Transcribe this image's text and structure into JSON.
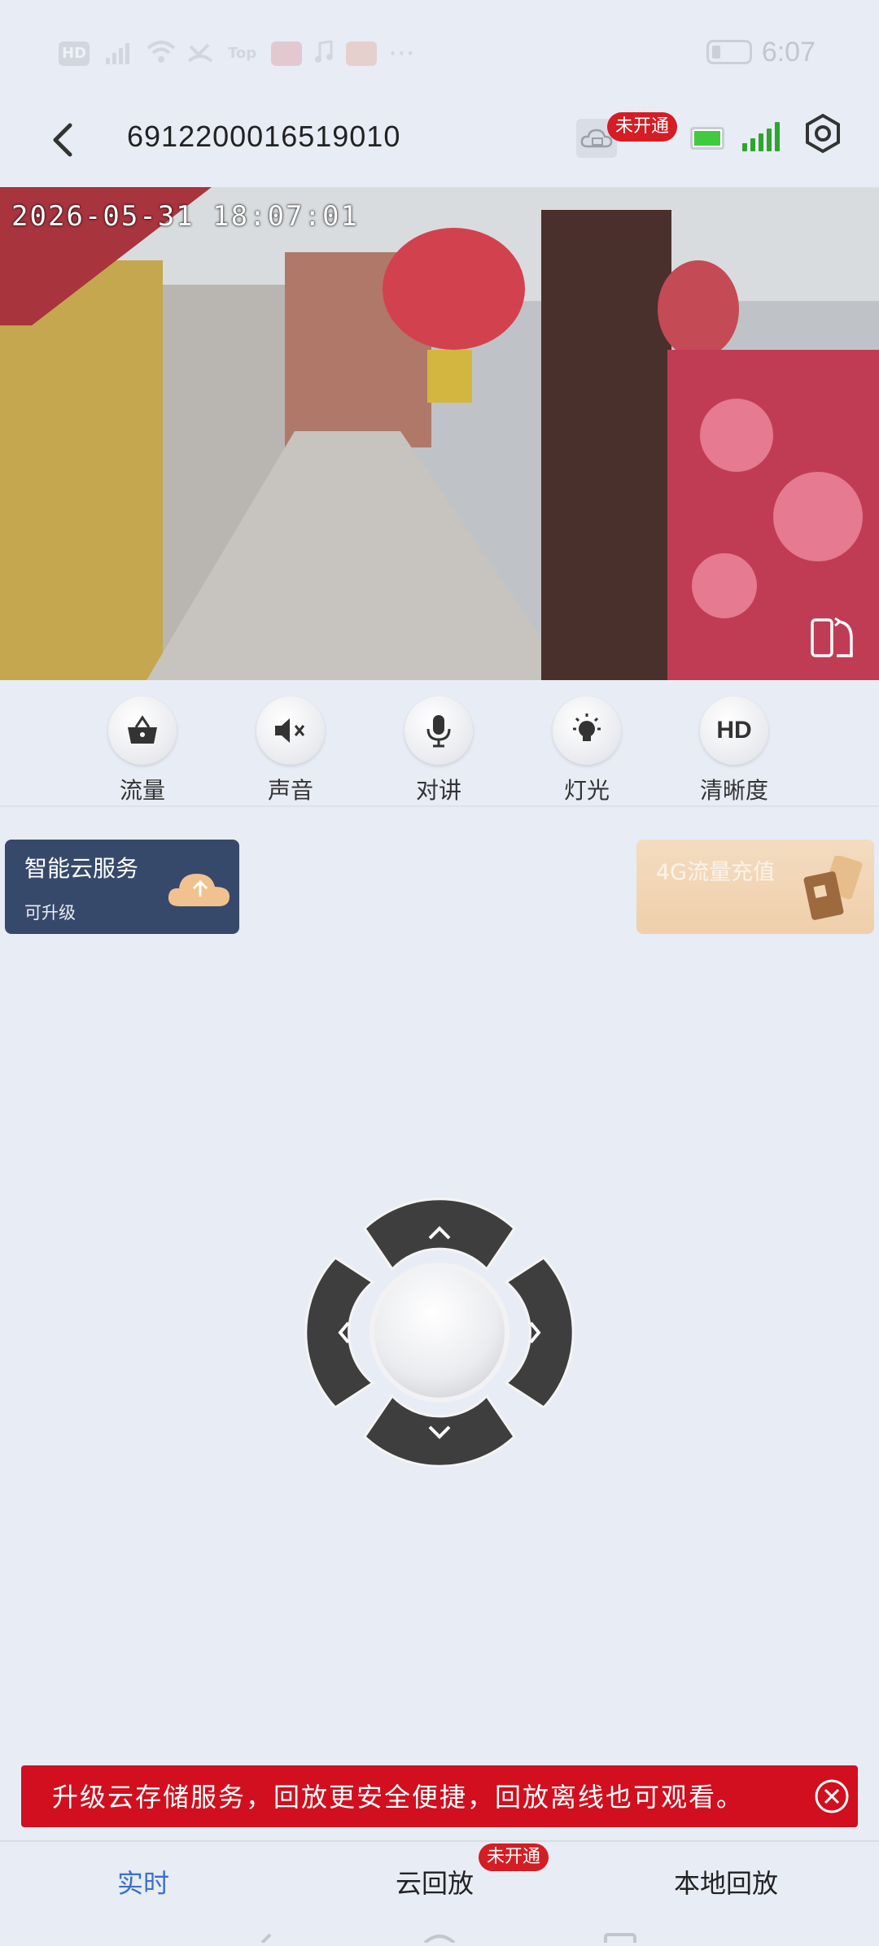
{
  "status_bar": {
    "left_icons": [
      "hd-icon",
      "4g-signal-icon",
      "wifi-icon",
      "missed-call-icon",
      "top-icon",
      "app-icon",
      "music-icon",
      "app2-icon",
      "more-dots-icon"
    ],
    "hd_label": "HD",
    "top_label": "Top",
    "dots": "···",
    "time": "6:07"
  },
  "header": {
    "title": "6912200016519010",
    "cloud_badge": "未开通"
  },
  "video": {
    "timestamp": "2026-05-31 18:07:01"
  },
  "controls": [
    {
      "label": "流量",
      "icon": "basket-icon"
    },
    {
      "label": "声音",
      "icon": "speaker-mute-icon"
    },
    {
      "label": "对讲",
      "icon": "microphone-icon"
    },
    {
      "label": "灯光",
      "icon": "light-bulb-icon"
    },
    {
      "label": "清晰度",
      "icon": "hd-icon",
      "icon_text": "HD"
    }
  ],
  "promo": {
    "cloud_title": "智能云服务",
    "cloud_sub": "可升级",
    "flow_title": "4G流量充值"
  },
  "banner": {
    "text": "升级云存储服务，回放更安全便捷，回放离线也可观看。"
  },
  "tabs": {
    "live": "实时",
    "cloud": "云回放",
    "cloud_badge": "未开通",
    "local": "本地回放"
  },
  "colors": {
    "accent": "#3a6fd0",
    "badge_red": "#d41d24",
    "banner_red": "#d10f1e",
    "card_navy": "#36496b",
    "background": "#e8ecf5"
  }
}
